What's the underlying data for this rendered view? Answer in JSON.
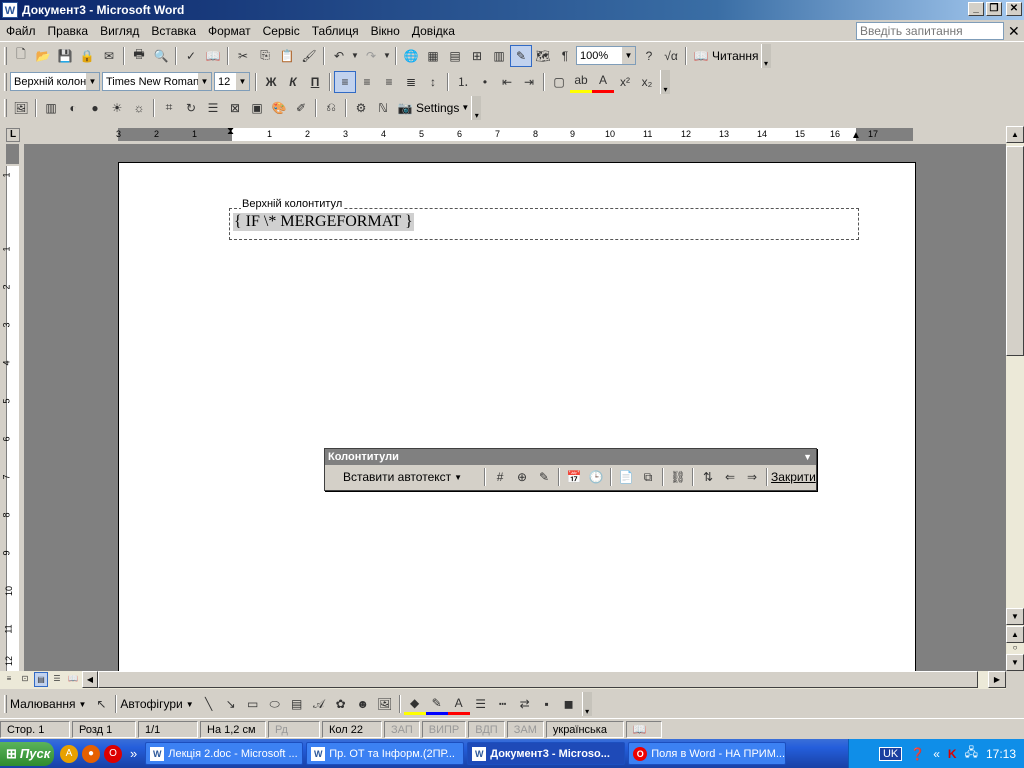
{
  "title": "Документ3 - Microsoft Word",
  "menu": [
    "Файл",
    "Правка",
    "Вигляд",
    "Вставка",
    "Формат",
    "Сервіс",
    "Таблиця",
    "Вікно",
    "Довідка"
  ],
  "ask": {
    "placeholder": "Введіть запитання"
  },
  "standard": {
    "zoom": "100%",
    "reading_label": "Читання"
  },
  "formatting": {
    "style": "Верхній колонт",
    "font": "Times New Roman",
    "size": "12",
    "bold": "Ж",
    "italic": "К",
    "underline": "П"
  },
  "picture_toolbar": {
    "settings_label": "Settings"
  },
  "ruler": {
    "h_ticks": [
      "3",
      "2",
      "1",
      "1",
      "2",
      "3",
      "4",
      "5",
      "6",
      "7",
      "8",
      "9",
      "10",
      "11",
      "12",
      "13",
      "14",
      "15",
      "16",
      "17"
    ],
    "v_ticks": [
      "1",
      "1",
      "2",
      "3",
      "4",
      "5",
      "6",
      "7",
      "8",
      "9",
      "10",
      "11",
      "12"
    ]
  },
  "document": {
    "header_label": "Верхній колонтитул",
    "field_code": "{ IF  \\* MERGEFORMAT }"
  },
  "hf_toolbar": {
    "title": "Колонтитули",
    "insert_autotext": "Вставити автотекст",
    "close": "Закрити"
  },
  "drawing": {
    "draw_label": "Малювання",
    "autoshapes_label": "Автофігури"
  },
  "status": {
    "page": "Стор.  1",
    "section": "Розд  1",
    "pages": "1/1",
    "at": "На  1,2 см",
    "line": "Рд",
    "col": "Кол  22",
    "rec": "ЗАП",
    "trk": "ВИПР",
    "ext": "ВДП",
    "ovr": "ЗАМ",
    "lang": "українська"
  },
  "taskbar": {
    "start": "Пуск",
    "tasks": [
      "Лекція 2.doc - Microsoft ...",
      "Пр. ОТ та Інформ.(2ПР...",
      "Документ3 - Microso...",
      "Поля в Word - НА ПРИМ..."
    ],
    "lang": "UK",
    "clock": "17:13"
  }
}
